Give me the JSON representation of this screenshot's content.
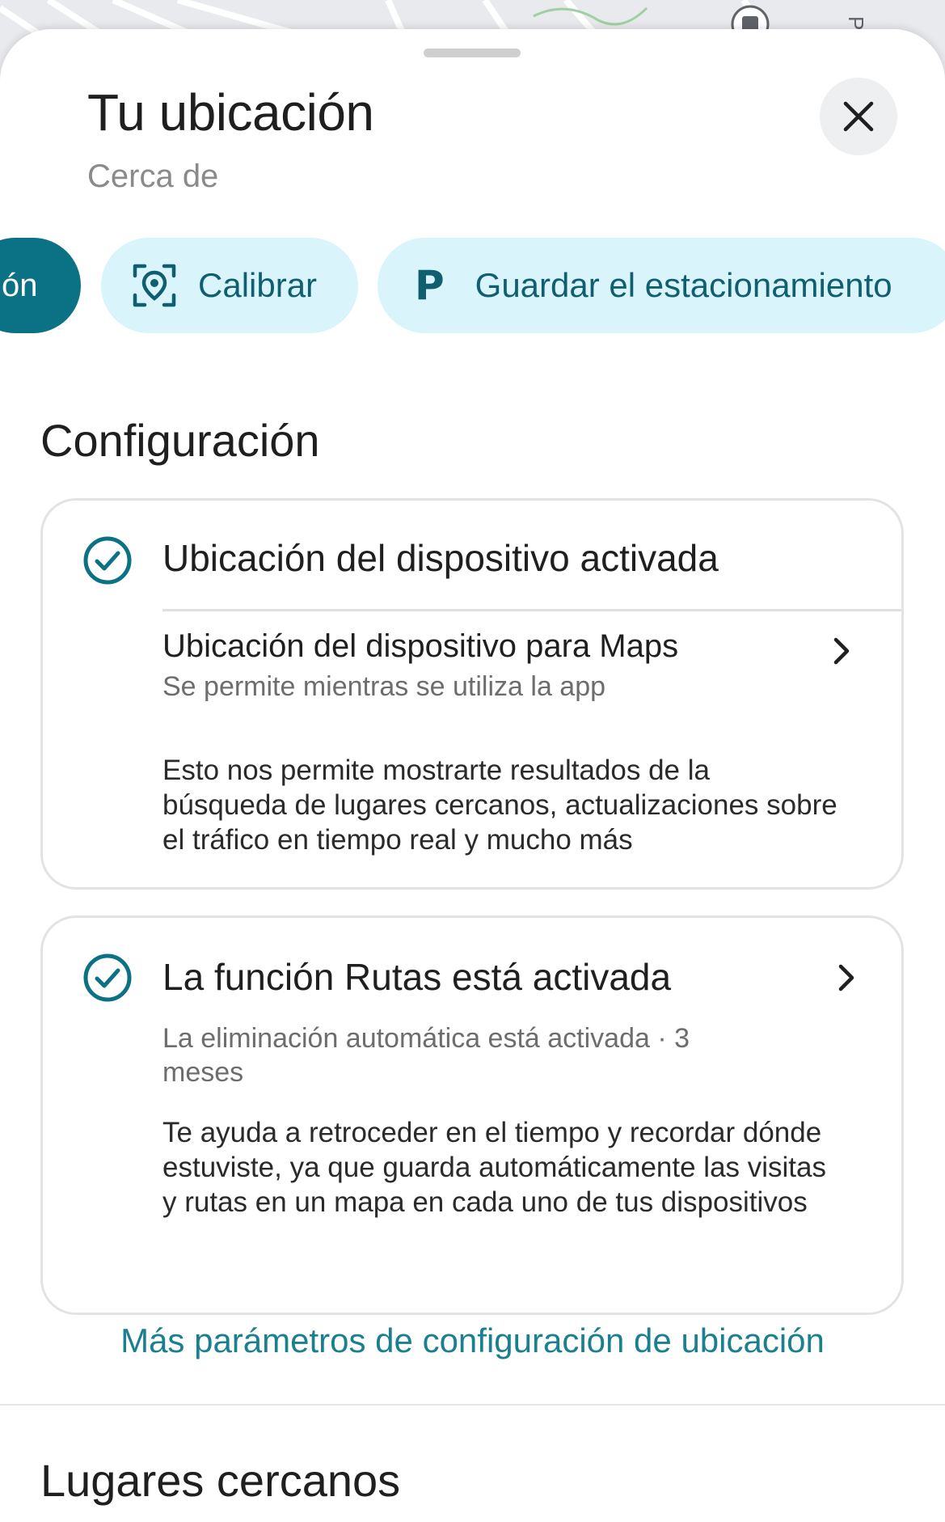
{
  "header": {
    "title": "Tu ubicación",
    "subtitle": "Cerca de"
  },
  "chips": {
    "partial_label": "ón",
    "calibrar": {
      "label": "Calibrar",
      "icon": "calibrate-location-icon"
    },
    "parking": {
      "label": "Guardar el estacionamiento",
      "icon_letter": "P"
    }
  },
  "configuracion": {
    "heading": "Configuración",
    "device_location": {
      "title": "Ubicación del dispositivo activada",
      "maps_row_title": "Ubicación del dispositivo para Maps",
      "maps_row_sub": "Se permite mientras se utiliza la app",
      "description": "Esto nos permite mostrarte resultados de la búsqueda de lugares cercanos, actualizaciones sobre el tráfico en tiempo real y mucho más"
    },
    "routes": {
      "title": "La función Rutas está activada",
      "sub": "La eliminación automática está activada · 3 meses",
      "description": "Te ayuda a retroceder en el tiempo y recordar dónde estuviste, ya que guarda automáticamente las visitas y rutas en un mapa en cada uno de tus dispositivos"
    },
    "more_link": "Más parámetros de configuración de ubicación"
  },
  "nearby": {
    "heading": "Lugares cercanos"
  },
  "map_label": "Pd",
  "colors": {
    "accent": "#0b7285",
    "chip_bg": "#d9f4fb",
    "chip_text": "#0f5f70",
    "link": "#1a7f8f"
  }
}
